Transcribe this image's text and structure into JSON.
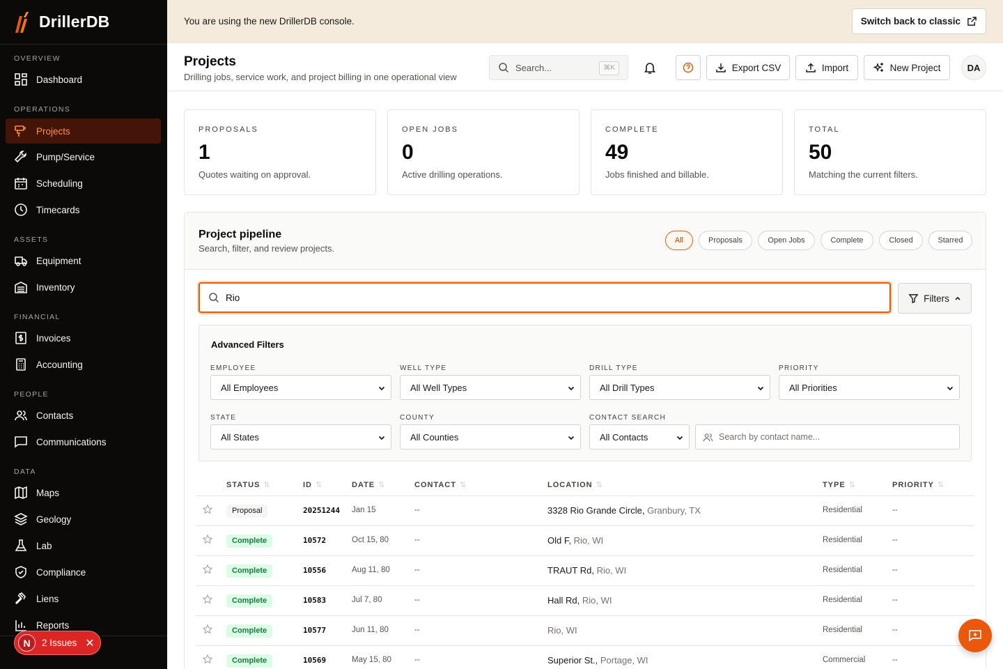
{
  "app": {
    "name": "DrillerDB"
  },
  "sidebar": {
    "sections": [
      "OVERVIEW",
      "OPERATIONS",
      "ASSETS",
      "FINANCIAL",
      "PEOPLE",
      "DATA"
    ],
    "items": [
      {
        "label": "Dashboard",
        "icon": "grid-icon"
      },
      {
        "label": "Projects",
        "icon": "drill-icon"
      },
      {
        "label": "Pump/Service",
        "icon": "wrench-icon"
      },
      {
        "label": "Scheduling",
        "icon": "calendar-icon"
      },
      {
        "label": "Timecards",
        "icon": "clock-icon"
      },
      {
        "label": "Equipment",
        "icon": "truck-icon"
      },
      {
        "label": "Inventory",
        "icon": "warehouse-icon"
      },
      {
        "label": "Invoices",
        "icon": "receipt-icon"
      },
      {
        "label": "Accounting",
        "icon": "calculator-icon"
      },
      {
        "label": "Contacts",
        "icon": "users-icon"
      },
      {
        "label": "Communications",
        "icon": "message-icon"
      },
      {
        "label": "Maps",
        "icon": "map-icon"
      },
      {
        "label": "Geology",
        "icon": "layers-icon"
      },
      {
        "label": "Lab",
        "icon": "flask-icon"
      },
      {
        "label": "Compliance",
        "icon": "shield-icon"
      },
      {
        "label": "Liens",
        "icon": "gavel-icon"
      },
      {
        "label": "Reports",
        "icon": "bar-chart-icon"
      }
    ],
    "issues": {
      "badge": "N",
      "label": "2 Issues",
      "close": "✕"
    }
  },
  "banner": {
    "text": "You are using the new DrillerDB console.",
    "button": "Switch back to classic"
  },
  "header": {
    "title": "Projects",
    "subtitle": "Drilling jobs, service work, and project billing in one operational view",
    "search_placeholder": "Search...",
    "shortcut": "⌘K",
    "export": "Export CSV",
    "import": "Import",
    "new_project": "New Project",
    "avatar": "DA"
  },
  "stats": [
    {
      "label": "PROPOSALS",
      "value": "1",
      "desc": "Quotes waiting on approval."
    },
    {
      "label": "OPEN JOBS",
      "value": "0",
      "desc": "Active drilling operations."
    },
    {
      "label": "COMPLETE",
      "value": "49",
      "desc": "Jobs finished and billable."
    },
    {
      "label": "TOTAL",
      "value": "50",
      "desc": "Matching the current filters."
    }
  ],
  "pipeline": {
    "title": "Project pipeline",
    "subtitle": "Search, filter, and review projects.",
    "chips": [
      "All",
      "Proposals",
      "Open Jobs",
      "Complete",
      "Closed",
      "Starred"
    ],
    "search_value": "Rio",
    "filters_label": "Filters"
  },
  "advanced": {
    "title": "Advanced Filters",
    "fields": [
      {
        "label": "EMPLOYEE",
        "value": "All Employees"
      },
      {
        "label": "WELL TYPE",
        "value": "All Well Types"
      },
      {
        "label": "DRILL TYPE",
        "value": "All Drill Types"
      },
      {
        "label": "PRIORITY",
        "value": "All Priorities"
      },
      {
        "label": "STATE",
        "value": "All States"
      },
      {
        "label": "COUNTY",
        "value": "All Counties"
      },
      {
        "label": "CONTACT SEARCH",
        "value": "All Contacts"
      }
    ],
    "contact_placeholder": "Search by contact name..."
  },
  "table": {
    "columns": [
      "STATUS",
      "ID",
      "DATE",
      "CONTACT",
      "LOCATION",
      "TYPE",
      "PRIORITY"
    ],
    "sort_glyph": "⇅",
    "rows": [
      {
        "status": "Proposal",
        "id": "20251244",
        "date": "Jan 15",
        "contact": "--",
        "street": "3328 Rio Grande Circle,",
        "city": "Granbury, TX",
        "type": "Residential",
        "priority": "--"
      },
      {
        "status": "Complete",
        "id": "10572",
        "date": "Oct 15, 80",
        "contact": "--",
        "street": "Old F,",
        "city": "Rio, WI",
        "type": "Residential",
        "priority": "--"
      },
      {
        "status": "Complete",
        "id": "10556",
        "date": "Aug 11, 80",
        "contact": "--",
        "street": "TRAUT Rd,",
        "city": "Rio, WI",
        "type": "Residential",
        "priority": "--"
      },
      {
        "status": "Complete",
        "id": "10583",
        "date": "Jul 7, 80",
        "contact": "--",
        "street": "Hall Rd,",
        "city": "Rio, WI",
        "type": "Residential",
        "priority": "--"
      },
      {
        "status": "Complete",
        "id": "10577",
        "date": "Jun 11, 80",
        "contact": "--",
        "street": "",
        "city": "Rio, WI",
        "type": "Residential",
        "priority": "--"
      },
      {
        "status": "Complete",
        "id": "10569",
        "date": "May 15, 80",
        "contact": "--",
        "street": "Superior St.,",
        "city": "Portage, WI",
        "type": "Commercial",
        "priority": "--"
      }
    ]
  },
  "colors": {
    "accent": "#ea580c",
    "sidebar_bg": "#0c0a09",
    "active_bg": "#431407",
    "complete_bg": "#dcfce7",
    "complete_fg": "#15803d"
  }
}
